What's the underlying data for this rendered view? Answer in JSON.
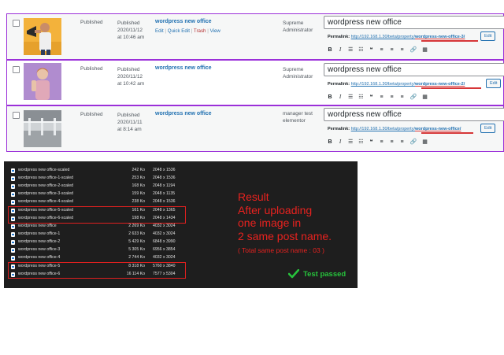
{
  "posts": [
    {
      "status": "Published",
      "date_line1": "Published",
      "date_line2": "2020/11/12",
      "date_line3": "at 10:46 am",
      "title": "wordpress new office",
      "actions": {
        "edit": "Edit",
        "quick_edit": "Quick Edit",
        "trash": "Trash",
        "view": "View",
        "sep": "|"
      },
      "author_line1": "Supreme",
      "author_line2": "Administrator",
      "editor_title": "wordpress new office",
      "permalink_label": "Permalink:",
      "permalink_base": "http://192.168.1.30/beta/property/",
      "permalink_slug": "wordpress-new-office-3/",
      "edit_label": "Edit"
    },
    {
      "status": "Published",
      "date_line1": "Published",
      "date_line2": "2020/11/12",
      "date_line3": "at 10:42 am",
      "title": "wordpress new office",
      "author_line1": "Supreme",
      "author_line2": "Administrator",
      "editor_title": "wordpress new office",
      "permalink_label": "Permalink:",
      "permalink_base": "http://192.168.1.30/beta/property/",
      "permalink_slug": "wordpress-new-office-2/",
      "edit_label": "Edit"
    },
    {
      "status": "Published",
      "date_line1": "Published",
      "date_line2": "2020/11/11",
      "date_line3": "at 8:14 am",
      "title": "wordpress new office",
      "author_line1": "manager test",
      "author_line2": "elementor",
      "editor_title": "wordpress new office",
      "permalink_label": "Permalink:",
      "permalink_base": "http://192.168.1.30/beta/property/",
      "permalink_slug": "wordpress-new-office/",
      "edit_label": "Edit"
    }
  ],
  "toolbar": {
    "bold": "B",
    "italic": "I",
    "ul": "☰",
    "ol": "☷",
    "quote": "❝",
    "align_left": "≡",
    "align_center": "≡",
    "align_right": "≡",
    "link": "🔗",
    "more": "▦"
  },
  "files": [
    {
      "name": "wordpress new office-scaled",
      "size": "242 Ko",
      "dims": "2048 x 1536"
    },
    {
      "name": "wordpress new office-1-scaled",
      "size": "253 Ko",
      "dims": "2048 x 1536"
    },
    {
      "name": "wordpress new office-2-scaled",
      "size": "168 Ko",
      "dims": "2048 x 1194"
    },
    {
      "name": "wordpress new office-3-scaled",
      "size": "159 Ko",
      "dims": "2048 x 1135"
    },
    {
      "name": "wordpress new office-4-scaled",
      "size": "238 Ko",
      "dims": "2048 x 1536"
    },
    {
      "name": "wordpress new office-5-scaled",
      "size": "161 Ko",
      "dims": "2048 x 1365"
    },
    {
      "name": "wordpress new office-6-scaled",
      "size": "198 Ko",
      "dims": "2048 x 1434"
    },
    {
      "name": "wordpress new office",
      "size": "2 269 Ko",
      "dims": "4032 x 3024"
    },
    {
      "name": "wordpress new office-1",
      "size": "2 633 Ko",
      "dims": "4032 x 3024"
    },
    {
      "name": "wordpress new office-2",
      "size": "5 429 Ko",
      "dims": "6848 x 3990"
    },
    {
      "name": "wordpress new office-3",
      "size": "5 305 Ko",
      "dims": "6956 x 3854"
    },
    {
      "name": "wordpress new office-4",
      "size": "2 744 Ko",
      "dims": "4032 x 3024"
    },
    {
      "name": "wordpress new office-5",
      "size": "8 318 Ko",
      "dims": "5760 x 3840"
    },
    {
      "name": "wordpress new office-6",
      "size": "16 114 Ko",
      "dims": "7577 x 5304"
    }
  ],
  "result": {
    "line1": "Result",
    "line2": "After uploading",
    "line3": "one image in",
    "line4": "2 same post name.",
    "note": "( Total same post name : 03 )",
    "passed": "Test passed"
  },
  "colors": {
    "accent": "#2271b1",
    "highlight": "#9b30d9",
    "alert": "#e8221f",
    "success": "#27c23c"
  }
}
